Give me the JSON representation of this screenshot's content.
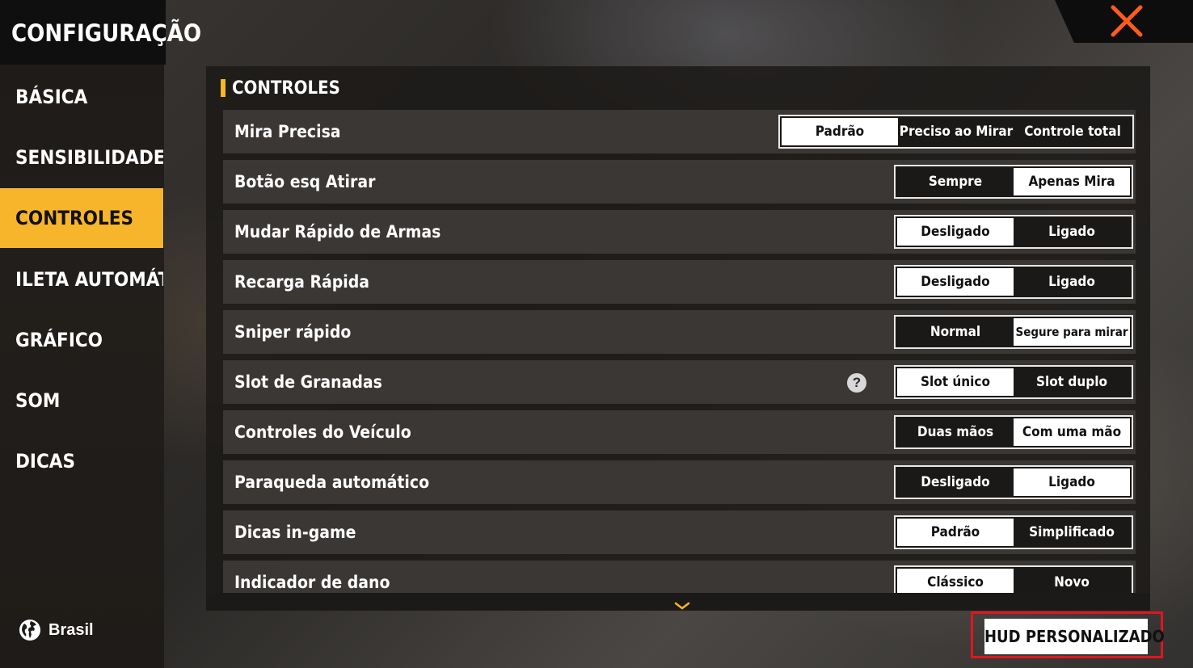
{
  "sidebar": {
    "title": "CONFIGURAÇÃO",
    "items": [
      {
        "label": "BÁSICA",
        "active": false
      },
      {
        "label": "SENSIBILIDADE",
        "active": false
      },
      {
        "label": "CONTROLES",
        "active": true
      },
      {
        "label": "ILETA AUTOMÁTICA",
        "active": false
      },
      {
        "label": "GRÁFICO",
        "active": false
      },
      {
        "label": "SOM",
        "active": false
      },
      {
        "label": "DICAS",
        "active": false
      }
    ],
    "region": {
      "icon": "globe-icon",
      "label": "Brasil"
    }
  },
  "close": {
    "icon": "close-icon",
    "color": "#ff5a1f"
  },
  "section": {
    "title": "CONTROLES",
    "accent": "#f7b52b"
  },
  "settings": [
    {
      "label": "Mira Precisa",
      "options": [
        "Padrão",
        "Preciso ao Mirar",
        "Controle total"
      ],
      "selected": 0
    },
    {
      "label": "Botão esq Atirar",
      "options": [
        "Sempre",
        "Apenas Mira"
      ],
      "selected": 1
    },
    {
      "label": "Mudar Rápido de Armas",
      "options": [
        "Desligado",
        "Ligado"
      ],
      "selected": 0
    },
    {
      "label": "Recarga Rápida",
      "options": [
        "Desligado",
        "Ligado"
      ],
      "selected": 0
    },
    {
      "label": "Sniper rápido",
      "options": [
        "Normal",
        "Segure para mirar"
      ],
      "selected": 1
    },
    {
      "label": "Slot de Granadas",
      "options": [
        "Slot único",
        "Slot duplo"
      ],
      "selected": 0,
      "help": "?"
    },
    {
      "label": "Controles do Veículo",
      "options": [
        "Duas mãos",
        "Com uma mão"
      ],
      "selected": 1
    },
    {
      "label": "Paraqueda automático",
      "options": [
        "Desligado",
        "Ligado"
      ],
      "selected": 1
    },
    {
      "label": "Dicas in-game",
      "options": [
        "Padrão",
        "Simplificado"
      ],
      "selected": 0
    },
    {
      "label": "Indicador de dano",
      "options": [
        "Clássico",
        "Novo"
      ],
      "selected": 0
    }
  ],
  "scroll_hint": {
    "icon": "chevron-down-icon",
    "color": "#f7b52b"
  },
  "hud_button": {
    "label": "HUD PERSONALIZADO",
    "highlight": "#e0161e"
  }
}
